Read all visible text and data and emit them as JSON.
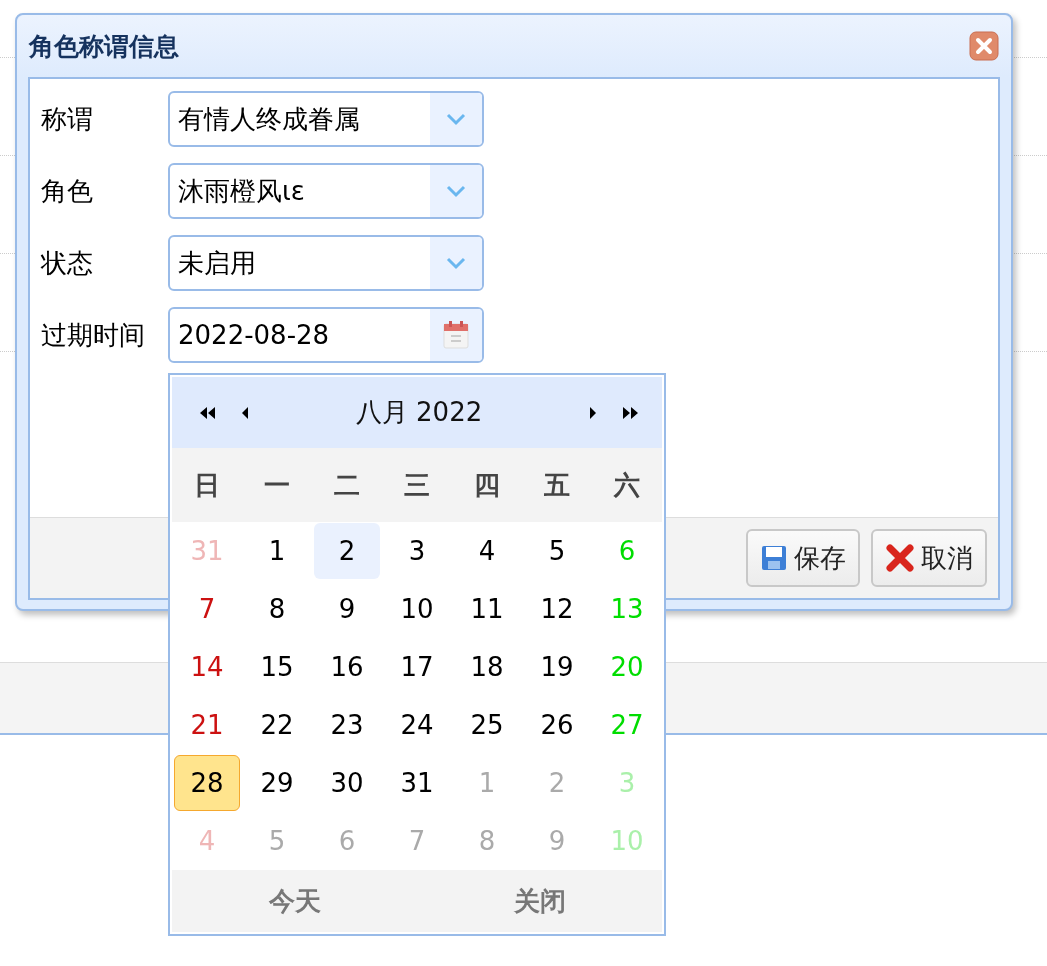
{
  "dialog": {
    "title": "角色称谓信息",
    "fields": [
      {
        "label": "称谓",
        "value": "有情人终成眷属",
        "kind": "combo"
      },
      {
        "label": "角色",
        "value": "沐雨橙风ιε",
        "kind": "combo"
      },
      {
        "label": "状态",
        "value": "未启用",
        "kind": "combo"
      },
      {
        "label": "过期时间",
        "value": "2022-08-28",
        "kind": "date"
      }
    ],
    "buttons": [
      {
        "label": "保存",
        "kind": "save"
      },
      {
        "label": "取消",
        "kind": "cancel"
      }
    ]
  },
  "calendar": {
    "month_title": "八月 2022",
    "weekdays": [
      "日",
      "一",
      "二",
      "三",
      "四",
      "五",
      "六"
    ],
    "days": [
      {
        "day": "31",
        "kind": "other",
        "selected": false,
        "highlighted": false
      },
      {
        "day": "1",
        "kind": "current",
        "selected": false,
        "highlighted": false
      },
      {
        "day": "2",
        "kind": "current",
        "selected": false,
        "highlighted": true
      },
      {
        "day": "3",
        "kind": "current",
        "selected": false,
        "highlighted": false
      },
      {
        "day": "4",
        "kind": "current",
        "selected": false,
        "highlighted": false
      },
      {
        "day": "5",
        "kind": "current",
        "selected": false,
        "highlighted": false
      },
      {
        "day": "6",
        "kind": "current",
        "selected": false,
        "highlighted": false
      },
      {
        "day": "7",
        "kind": "current",
        "selected": false,
        "highlighted": false
      },
      {
        "day": "8",
        "kind": "current",
        "selected": false,
        "highlighted": false
      },
      {
        "day": "9",
        "kind": "current",
        "selected": false,
        "highlighted": false
      },
      {
        "day": "10",
        "kind": "current",
        "selected": false,
        "highlighted": false
      },
      {
        "day": "11",
        "kind": "current",
        "selected": false,
        "highlighted": false
      },
      {
        "day": "12",
        "kind": "current",
        "selected": false,
        "highlighted": false
      },
      {
        "day": "13",
        "kind": "current",
        "selected": false,
        "highlighted": false
      },
      {
        "day": "14",
        "kind": "current",
        "selected": false,
        "highlighted": false
      },
      {
        "day": "15",
        "kind": "current",
        "selected": false,
        "highlighted": false
      },
      {
        "day": "16",
        "kind": "current",
        "selected": false,
        "highlighted": false
      },
      {
        "day": "17",
        "kind": "current",
        "selected": false,
        "highlighted": false
      },
      {
        "day": "18",
        "kind": "current",
        "selected": false,
        "highlighted": false
      },
      {
        "day": "19",
        "kind": "current",
        "selected": false,
        "highlighted": false
      },
      {
        "day": "20",
        "kind": "current",
        "selected": false,
        "highlighted": false
      },
      {
        "day": "21",
        "kind": "current",
        "selected": false,
        "highlighted": false
      },
      {
        "day": "22",
        "kind": "current",
        "selected": false,
        "highlighted": false
      },
      {
        "day": "23",
        "kind": "current",
        "selected": false,
        "highlighted": false
      },
      {
        "day": "24",
        "kind": "current",
        "selected": false,
        "highlighted": false
      },
      {
        "day": "25",
        "kind": "current",
        "selected": false,
        "highlighted": false
      },
      {
        "day": "26",
        "kind": "current",
        "selected": false,
        "highlighted": false
      },
      {
        "day": "27",
        "kind": "current",
        "selected": false,
        "highlighted": false
      },
      {
        "day": "28",
        "kind": "current",
        "selected": true,
        "highlighted": false
      },
      {
        "day": "29",
        "kind": "current",
        "selected": false,
        "highlighted": false
      },
      {
        "day": "30",
        "kind": "current",
        "selected": false,
        "highlighted": false
      },
      {
        "day": "31",
        "kind": "current",
        "selected": false,
        "highlighted": false
      },
      {
        "day": "1",
        "kind": "other",
        "selected": false,
        "highlighted": false
      },
      {
        "day": "2",
        "kind": "other",
        "selected": false,
        "highlighted": false
      },
      {
        "day": "3",
        "kind": "other",
        "selected": false,
        "highlighted": false
      },
      {
        "day": "4",
        "kind": "other",
        "selected": false,
        "highlighted": false
      },
      {
        "day": "5",
        "kind": "other",
        "selected": false,
        "highlighted": false
      },
      {
        "day": "6",
        "kind": "other",
        "selected": false,
        "highlighted": false
      },
      {
        "day": "7",
        "kind": "other",
        "selected": false,
        "highlighted": false
      },
      {
        "day": "8",
        "kind": "other",
        "selected": false,
        "highlighted": false
      },
      {
        "day": "9",
        "kind": "other",
        "selected": false,
        "highlighted": false
      },
      {
        "day": "10",
        "kind": "other",
        "selected": false,
        "highlighted": false
      }
    ],
    "today_button": "今天",
    "close_button": "关闭"
  }
}
